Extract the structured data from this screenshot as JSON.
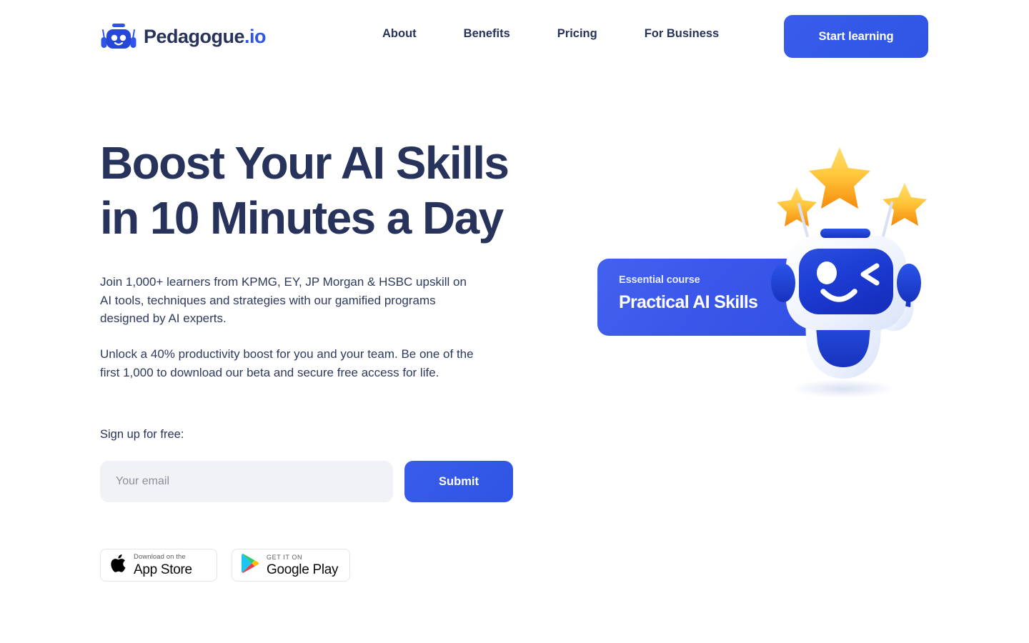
{
  "brand": {
    "logo_icon": "robot-head-icon",
    "name": "Pedagogue",
    "tld": ".io"
  },
  "header": {
    "nav": [
      {
        "label": "About",
        "name": "nav-item-about"
      },
      {
        "label": "Benefits",
        "name": "nav-item-benefits"
      },
      {
        "label": "Pricing",
        "name": "nav-item-pricing"
      },
      {
        "label": "For Business",
        "name": "nav-item-for-business"
      }
    ],
    "cta_label": "Start learning"
  },
  "hero": {
    "headline": "Boost Your AI Skills in 10 Minutes a Day",
    "paragraph_1": "Join 1,000+ learners from KPMG, EY, JP Morgan & HSBC upskill on AI tools, techniques and strategies with our gamified programs designed by AI experts.",
    "paragraph_2": "Unlock a 40% productivity boost for you and your team. Be one of the first 1,000 to download our beta and secure free access for life.",
    "signup_label": "Sign up for free:",
    "email_placeholder": "Your email",
    "email_value": "",
    "submit_label": "Submit"
  },
  "store_badges": [
    {
      "name": "app-store-badge",
      "icon": "apple-logo-icon",
      "small_text": "Download on the",
      "big_text": "App Store"
    },
    {
      "name": "google-play-badge",
      "icon": "google-play-icon",
      "small_text": "GET IT ON",
      "big_text": "Google Play"
    }
  ],
  "course_card": {
    "eyebrow": "Essential course",
    "title": "Practical AI Skills",
    "illustration": "robot-mascot-with-stars"
  },
  "colors": {
    "brand_blue": "#3458E6",
    "navy_text": "#28335C",
    "card_gradient_start": "#4361EE",
    "card_gradient_end": "#2F4FE2",
    "input_background": "#F1F2F5",
    "star_gold": "#FFC93C",
    "star_orange": "#F79009",
    "robot_blue": "#1A3FD4"
  }
}
